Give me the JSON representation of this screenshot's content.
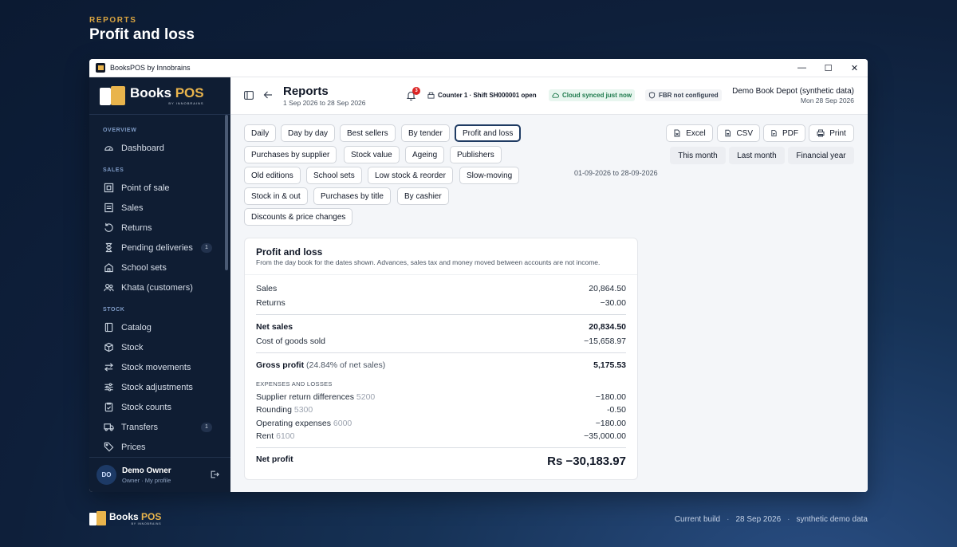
{
  "page": {
    "eyebrow": "REPORTS",
    "title": "Profit and loss"
  },
  "window": {
    "title": "BooksPOS by Innobrains",
    "controls": [
      "—",
      "☐",
      "✕"
    ]
  },
  "brand": {
    "name_part1": "Books ",
    "name_part2": "POS",
    "tagline": "BY INNOBRAINS"
  },
  "sidebar": {
    "sections": {
      "overview": "OVERVIEW",
      "sales": "SALES",
      "stock": "STOCK"
    },
    "items": {
      "dashboard": "Dashboard",
      "point_of_sale": "Point of sale",
      "sales": "Sales",
      "returns": "Returns",
      "pending_deliveries": "Pending deliveries",
      "pending_deliveries_badge": "1",
      "school_sets": "School sets",
      "khata": "Khata (customers)",
      "catalog": "Catalog",
      "stock": "Stock",
      "stock_movements": "Stock movements",
      "stock_adjustments": "Stock adjustments",
      "stock_counts": "Stock counts",
      "transfers": "Transfers",
      "transfers_badge": "1",
      "prices": "Prices"
    },
    "profile": {
      "initials": "DO",
      "name": "Demo Owner",
      "sub": "Owner · My profile"
    }
  },
  "topbar": {
    "title": "Reports",
    "subtitle": "1 Sep 2026 to 28 Sep 2026",
    "notif_count": "3",
    "counter": "Counter 1 · Shift SH000001 open",
    "cloud": "Cloud synced just now",
    "fbr": "FBR not configured",
    "store_name": "Demo Book Depot (synthetic data)",
    "store_date": "Mon 28 Sep 2026"
  },
  "report_tabs": {
    "daily": "Daily",
    "day_by_day": "Day by day",
    "best_sellers": "Best sellers",
    "by_tender": "By tender",
    "profit_and_loss": "Profit and loss",
    "purchases_by_supplier": "Purchases by supplier",
    "stock_value": "Stock value",
    "ageing": "Ageing",
    "publishers": "Publishers",
    "old_editions": "Old editions",
    "school_sets": "School sets",
    "low_stock": "Low stock & reorder",
    "slow_moving": "Slow-moving",
    "stock_in_out": "Stock in & out",
    "purchases_by_title": "Purchases by title",
    "by_cashier": "By cashier",
    "discounts": "Discounts & price changes"
  },
  "export": {
    "excel": "Excel",
    "csv": "CSV",
    "pdf": "PDF",
    "print": "Print"
  },
  "period": {
    "range": "01-09-2026 to 28-09-2026",
    "this_month": "This month",
    "last_month": "Last month",
    "financial_year": "Financial year"
  },
  "statement": {
    "title": "Profit and loss",
    "description": "From the day book for the dates shown. Advances, sales tax and money moved between accounts are not income.",
    "sales_label": "Sales",
    "sales": "20,864.50",
    "returns_label": "Returns",
    "returns": "−30.00",
    "net_sales_label": "Net sales",
    "net_sales": "20,834.50",
    "cogs_label": "Cost of goods sold",
    "cogs": "−15,658.97",
    "gross_label": "Gross profit",
    "gross_pct": "(24.84% of net sales)",
    "gross": "5,175.53",
    "expenses_header": "EXPENSES AND LOSSES",
    "expenses": [
      {
        "label": "Supplier return differences",
        "code": "5200",
        "amount": "−180.00"
      },
      {
        "label": "Rounding",
        "code": "5300",
        "amount": "-0.50"
      },
      {
        "label": "Operating expenses",
        "code": "6000",
        "amount": "−180.00"
      },
      {
        "label": "Rent",
        "code": "6100",
        "amount": "−35,000.00"
      }
    ],
    "net_profit_label": "Net profit",
    "net_profit": "Rs −30,183.97"
  },
  "footer": {
    "build_label": "Current build",
    "build_date": "28 Sep 2026",
    "note": "synthetic demo data"
  },
  "colors": {
    "accent_gold": "#e9b44c",
    "sidebar_bg": "#0f1d33",
    "active_tab_border": "#1f3b63",
    "cloud_green": "#1f7a4d",
    "badge_red": "#dc2626"
  }
}
